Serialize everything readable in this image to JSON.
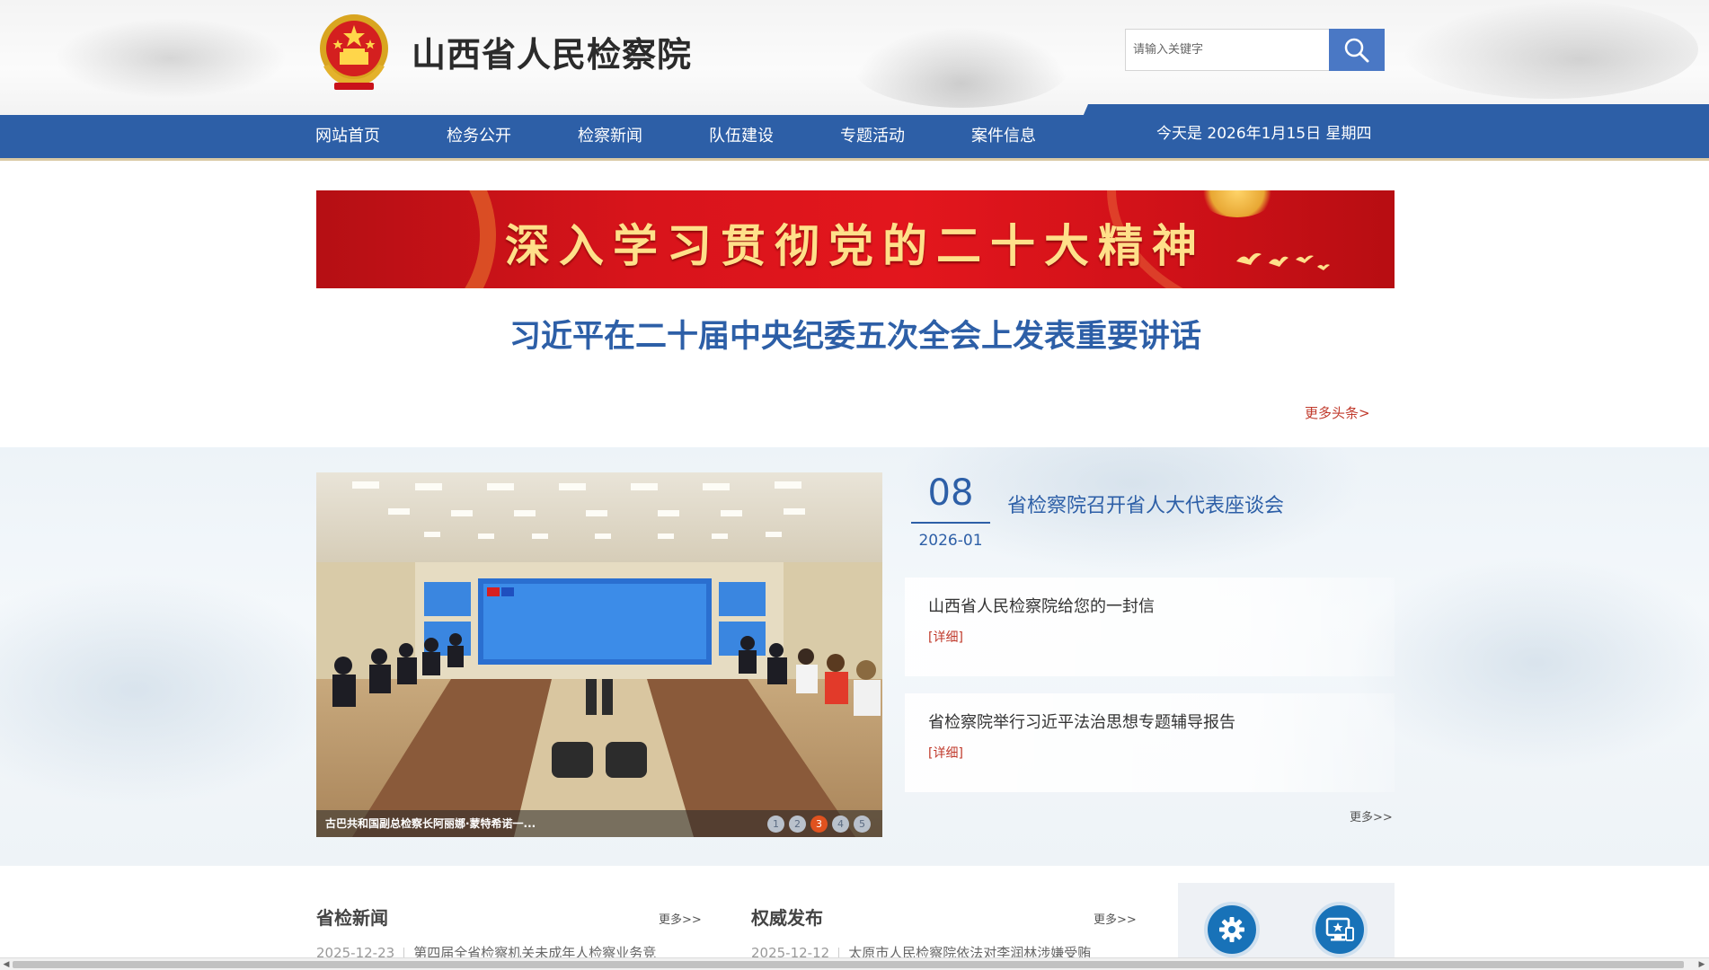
{
  "header": {
    "site_title": "山西省人民检察院",
    "search": {
      "placeholder": "请输入关键字"
    }
  },
  "nav": {
    "items": [
      "网站首页",
      "检务公开",
      "检察新闻",
      "队伍建设",
      "专题活动",
      "案件信息"
    ],
    "date_text": "今天是 2026年1月15日 星期四"
  },
  "banner": {
    "text": "深入学习贯彻党的二十大精神"
  },
  "headline": {
    "title": "习近平在二十届中央纪委五次全会上发表重要讲话",
    "more_label": "更多头条>"
  },
  "featured": {
    "photo_caption": "古巴共和国副总检察长阿丽娜·蒙特希诺一...",
    "carousel": {
      "pages": [
        "1",
        "2",
        "3",
        "4",
        "5"
      ],
      "active_page": "3"
    },
    "top_news": {
      "day": "08",
      "month": "2026-01",
      "title": "省检察院召开省人大代表座谈会"
    },
    "news": [
      {
        "title": "山西省人民检察院给您的一封信",
        "link_label": "[详细]"
      },
      {
        "title": "省检察院举行习近平法治思想专题辅导报告",
        "link_label": "[详细]"
      }
    ],
    "more_label": "更多>>"
  },
  "sections": {
    "province_news": {
      "title": "省检新闻",
      "more_label": "更多>>",
      "first_item": {
        "date": "2025-12-23",
        "title": "第四届全省检察机关未成年人检察业务竞"
      }
    },
    "authority": {
      "title": "权威发布",
      "more_label": "更多>>",
      "first_item": {
        "date": "2025-12-12",
        "title": "太原市人民检察院依法对李润林涉嫌受贿"
      }
    }
  },
  "side_panel": {
    "icons": [
      "gear-icon",
      "screen-star-icon"
    ]
  },
  "colors": {
    "nav_blue": "#2d5fa7",
    "accent_red": "#c0392b",
    "banner_red": "#d8141b",
    "banner_text": "#ffe08a"
  }
}
